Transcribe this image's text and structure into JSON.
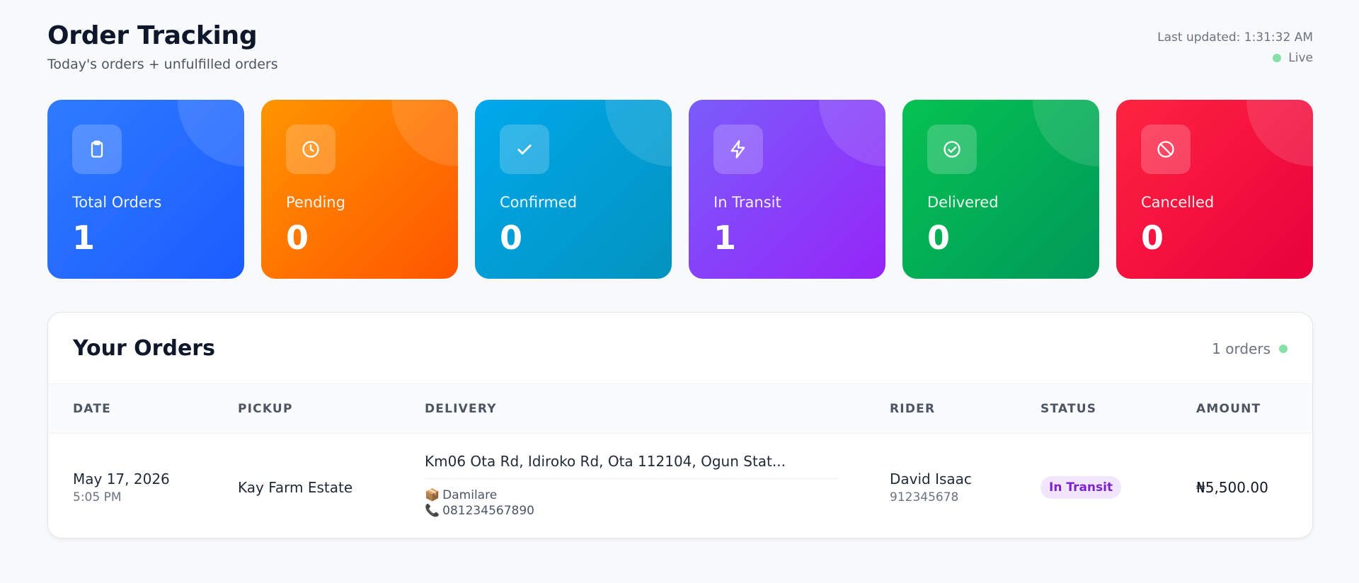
{
  "header": {
    "title": "Order Tracking",
    "subtitle": "Today's orders + unfulfilled orders",
    "last_updated": "Last updated: 1:31:32 AM",
    "live_label": "Live"
  },
  "colors": {
    "live_dot": "#86e0a8",
    "status_in_transit_bg": "#f1e6fd",
    "status_in_transit_text": "#7e22ce"
  },
  "stats": [
    {
      "label": "Total Orders",
      "value": "1",
      "icon": "clipboard-icon",
      "color": "#2f7bff"
    },
    {
      "label": "Pending",
      "value": "0",
      "icon": "clock-icon",
      "color": "#ff9500"
    },
    {
      "label": "Confirmed",
      "value": "0",
      "icon": "check-icon",
      "color": "#00a8ec"
    },
    {
      "label": "In Transit",
      "value": "1",
      "icon": "lightning-icon",
      "color": "#7a5cfb"
    },
    {
      "label": "Delivered",
      "value": "0",
      "icon": "check-circle-icon",
      "color": "#05c251"
    },
    {
      "label": "Cancelled",
      "value": "0",
      "icon": "ban-icon",
      "color": "#ff2440"
    }
  ],
  "orders": {
    "title": "Your Orders",
    "count_label": "1 orders",
    "columns": [
      "DATE",
      "PICKUP",
      "DELIVERY",
      "RIDER",
      "STATUS",
      "AMOUNT"
    ],
    "rows": [
      {
        "date": "May 17, 2026",
        "time": "5:05 PM",
        "pickup": "Kay Farm Estate",
        "delivery_address": "Km06 Ota Rd, Idiroko Rd, Ota 112104, Ogun Stat...",
        "recipient_icon": "📦",
        "recipient": "Damilare",
        "phone_icon": "📞",
        "phone": "081234567890",
        "rider_name": "David Isaac",
        "rider_phone": "912345678",
        "status": "In Transit",
        "amount": "₦5,500.00"
      }
    ]
  }
}
